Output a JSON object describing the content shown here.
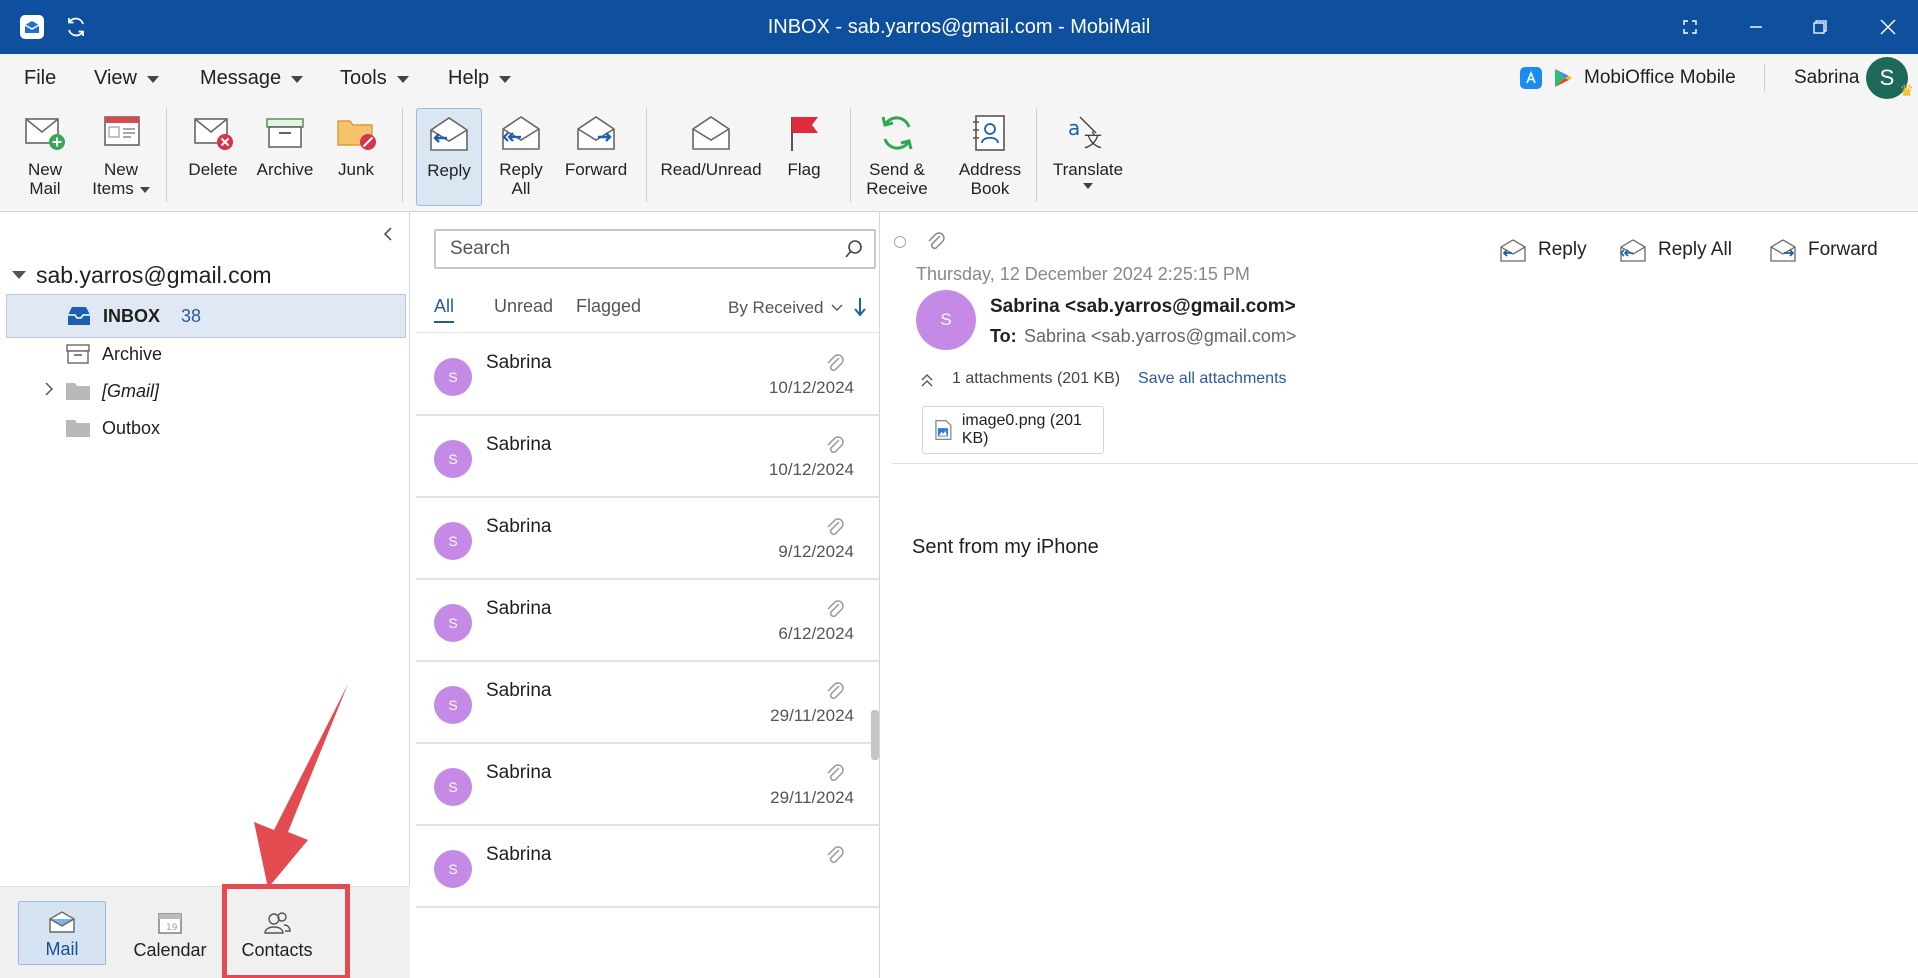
{
  "window": {
    "title": "INBOX - sab.yarros@gmail.com - MobiMail",
    "app_icon": "mobimail-app-icon",
    "sync_icon": "sync-icon",
    "controls": [
      "fullscreen-icon",
      "minimize-icon",
      "restore-icon",
      "close-icon"
    ]
  },
  "menubar": {
    "items": [
      {
        "label": "File",
        "has_caret": false
      },
      {
        "label": "View",
        "has_caret": true
      },
      {
        "label": "Message",
        "has_caret": true
      },
      {
        "label": "Tools",
        "has_caret": true
      },
      {
        "label": "Help",
        "has_caret": true
      }
    ],
    "promo_label": "MobiOffice Mobile",
    "user_name": "Sabrina",
    "user_avatar_initial": "S"
  },
  "ribbon": {
    "buttons": {
      "new_mail": "New\nMail",
      "new_items": "New\nItems",
      "delete": "Delete",
      "archive": "Archive",
      "junk": "Junk",
      "reply": "Reply",
      "reply_all": "Reply\nAll",
      "forward": "Forward",
      "read_unread": "Read/Unread",
      "flag": "Flag",
      "send_receive": "Send &\nReceive",
      "address_book": "Address\nBook",
      "translate": "Translate"
    },
    "active_button": "reply"
  },
  "nav": {
    "account": "sab.yarros@gmail.com",
    "folders": [
      {
        "label": "INBOX",
        "count": "38",
        "selected": true,
        "icon": "inbox-icon"
      },
      {
        "label": "Archive",
        "count": "",
        "selected": false,
        "icon": "archive-box-icon"
      },
      {
        "label": "[Gmail]",
        "count": "",
        "selected": false,
        "icon": "folder-icon"
      },
      {
        "label": "Outbox",
        "count": "",
        "selected": false,
        "icon": "folder-icon"
      }
    ],
    "modules": {
      "mail": "Mail",
      "calendar": "Calendar",
      "contacts": "Contacts"
    },
    "active_module": "Mail",
    "annotation_color": "#e34b50"
  },
  "message_list": {
    "search_placeholder": "Search",
    "filters": [
      "All",
      "Unread",
      "Flagged"
    ],
    "active_filter": "All",
    "sort_label": "By Received",
    "messages": [
      {
        "sender": "Sabrina",
        "initial": "S",
        "date": "10/12/2024",
        "has_attachment": true
      },
      {
        "sender": "Sabrina",
        "initial": "S",
        "date": "10/12/2024",
        "has_attachment": true
      },
      {
        "sender": "Sabrina",
        "initial": "S",
        "date": "9/12/2024",
        "has_attachment": true
      },
      {
        "sender": "Sabrina",
        "initial": "S",
        "date": "6/12/2024",
        "has_attachment": true
      },
      {
        "sender": "Sabrina",
        "initial": "S",
        "date": "29/11/2024",
        "has_attachment": true
      },
      {
        "sender": "Sabrina",
        "initial": "S",
        "date": "29/11/2024",
        "has_attachment": true
      },
      {
        "sender": "Sabrina",
        "initial": "S",
        "date": "",
        "has_attachment": true
      }
    ]
  },
  "reading_pane": {
    "date": "Thursday, 12 December 2024 2:25:15 PM",
    "actions": {
      "reply": "Reply",
      "reply_all": "Reply All",
      "forward": "Forward"
    },
    "sender_initial": "S",
    "from": "Sabrina <sab.yarros@gmail.com>",
    "to_label": "To:",
    "to": "Sabrina <sab.yarros@gmail.com>",
    "attachments_summary": "1 attachments (201 KB)",
    "save_all_label": "Save all attachments",
    "attachment_name": "image0.png (201 KB)",
    "body": "Sent from my iPhone"
  },
  "colors": {
    "titlebar": "#0e4f9e",
    "accent": "#2a5a9a",
    "avatar": "#c48ae6",
    "user_avatar": "#1e6a5a"
  }
}
